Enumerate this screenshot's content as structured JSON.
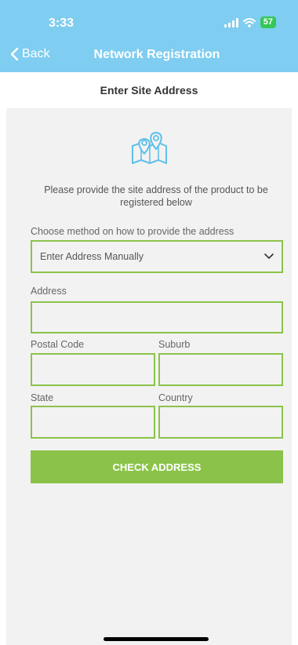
{
  "status_bar": {
    "time": "3:33",
    "battery": "57"
  },
  "nav": {
    "back_label": "Back",
    "title": "Network Registration"
  },
  "page": {
    "subtitle": "Enter Site Address"
  },
  "form": {
    "intro": "Please provide the site address of the product to be registered below",
    "method_label": "Choose method on how to provide the address",
    "method_value": "Enter Address Manually",
    "address_label": "Address",
    "address_value": "",
    "postal_code_label": "Postal Code",
    "postal_code_value": "",
    "suburb_label": "Suburb",
    "suburb_value": "",
    "state_label": "State",
    "state_value": "",
    "country_label": "Country",
    "country_value": "",
    "check_button": "CHECK ADDRESS"
  },
  "icons": {
    "back": "chevron-left-icon",
    "map": "map-pins-icon",
    "dropdown": "chevron-down-icon"
  },
  "colors": {
    "header_bg": "#7fcdf0",
    "accent_green": "#8bc34a",
    "content_bg": "#f2f2f2",
    "battery_green": "#34c759"
  }
}
